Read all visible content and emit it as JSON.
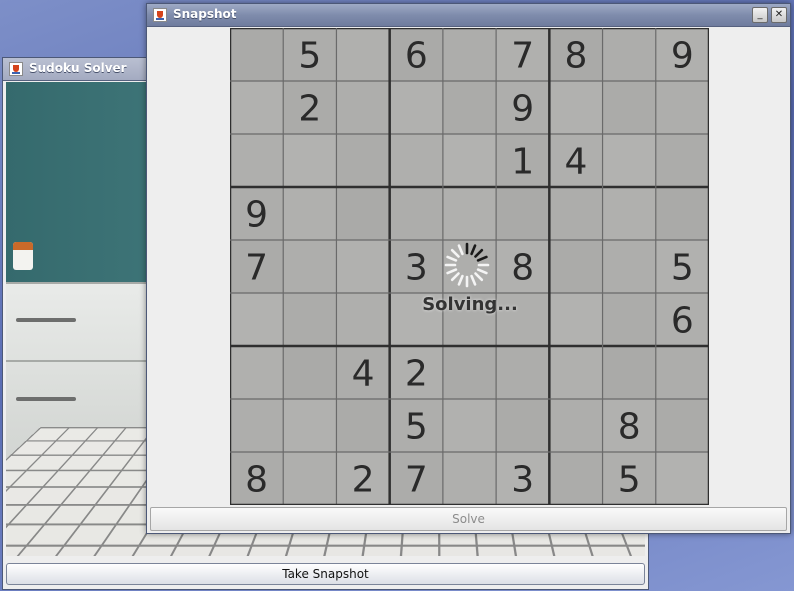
{
  "solver_window": {
    "title": "Sudoku Solver",
    "take_snapshot_label": "Take Snapshot"
  },
  "snapshot_window": {
    "title": "Snapshot",
    "minimize_glyph": "_",
    "close_glyph": "✕",
    "solving_text": "Solving...",
    "solve_label": "Solve",
    "solve_enabled": false
  },
  "puzzle": {
    "grid": [
      [
        "",
        "5",
        "",
        "6",
        "",
        "7",
        "8",
        "",
        "9"
      ],
      [
        "",
        "2",
        "",
        "",
        "",
        "9",
        "",
        "",
        ""
      ],
      [
        "",
        "",
        "",
        "",
        "",
        "1",
        "4",
        "",
        ""
      ],
      [
        "9",
        "",
        "",
        "",
        "",
        "",
        "",
        "",
        ""
      ],
      [
        "7",
        "",
        "",
        "3",
        "",
        "8",
        "",
        "",
        "5"
      ],
      [
        "",
        "",
        "",
        "",
        "",
        "",
        "",
        "",
        "6"
      ],
      [
        "",
        "",
        "4",
        "2",
        "",
        "",
        "",
        "",
        ""
      ],
      [
        "",
        "",
        "",
        "5",
        "",
        "",
        "",
        "8",
        ""
      ],
      [
        "8",
        "",
        "2",
        "7",
        "",
        "3",
        "",
        "5",
        ""
      ]
    ]
  },
  "icons": {
    "window_icon": "java-app-icon",
    "busy": "spinner-icon"
  },
  "colors": {
    "titlebar": "#7f8cac",
    "desktop": "#6b7dc0"
  }
}
